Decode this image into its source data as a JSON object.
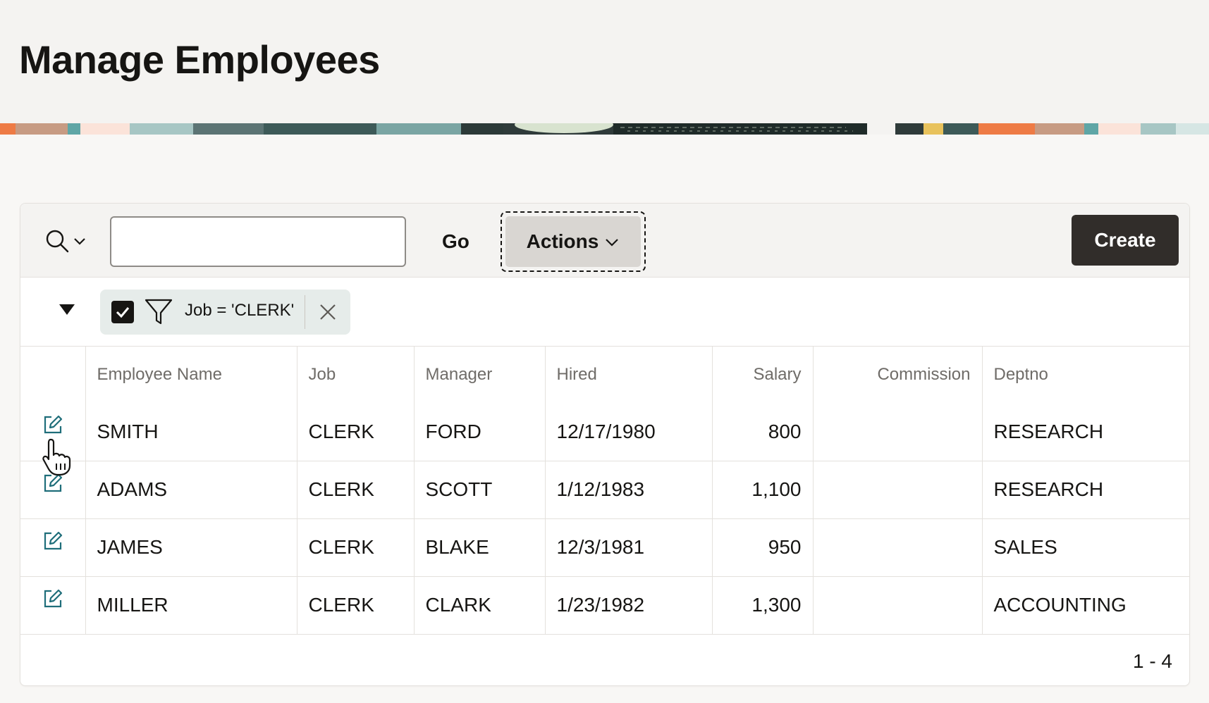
{
  "page": {
    "title": "Manage Employees"
  },
  "colors": {
    "header_bg": "#f4f3f1",
    "create_button": "#312d2a",
    "edit_icon": "#1f6e7a",
    "filter_chip": "#e6ecea"
  },
  "toolbar": {
    "search_icon": "search-icon",
    "search_value": "",
    "search_placeholder": "",
    "go_label": "Go",
    "actions_label": "Actions",
    "create_label": "Create"
  },
  "filter": {
    "enabled": true,
    "label": "Job = 'CLERK'"
  },
  "report": {
    "columns": [
      "Employee Name",
      "Job",
      "Manager",
      "Hired",
      "Salary",
      "Commission",
      "Deptno"
    ],
    "rows": [
      {
        "name": "SMITH",
        "job": "CLERK",
        "manager": "FORD",
        "hired": "12/17/1980",
        "salary": "800",
        "commission": "",
        "deptno": "RESEARCH"
      },
      {
        "name": "ADAMS",
        "job": "CLERK",
        "manager": "SCOTT",
        "hired": "1/12/1983",
        "salary": "1,100",
        "commission": "",
        "deptno": "RESEARCH"
      },
      {
        "name": "JAMES",
        "job": "CLERK",
        "manager": "BLAKE",
        "hired": "12/3/1981",
        "salary": "950",
        "commission": "",
        "deptno": "SALES"
      },
      {
        "name": "MILLER",
        "job": "CLERK",
        "manager": "CLARK",
        "hired": "1/23/1982",
        "salary": "1,300",
        "commission": "",
        "deptno": "ACCOUNTING"
      }
    ],
    "pagination": "1 - 4"
  }
}
